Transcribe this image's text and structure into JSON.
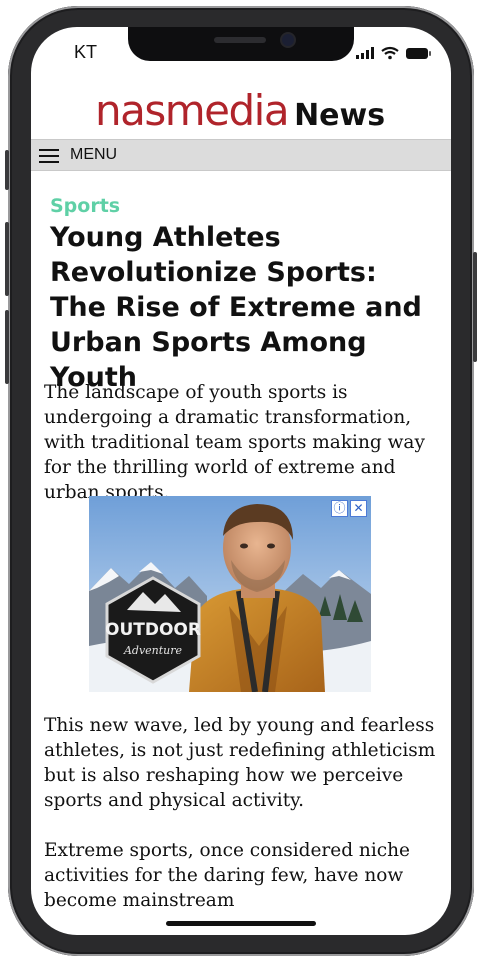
{
  "status_bar": {
    "carrier": "KT"
  },
  "header": {
    "brand": "nasmedia",
    "section": "News",
    "menu_label": "MENU"
  },
  "article": {
    "category": "Sports",
    "headline": "Young Athletes Revolutionize Sports: The Rise of Extreme and Urban Sports Among Youth",
    "paragraphs": [
      "The landscape of youth sports is undergoing a dramatic transformation, with traditional team sports making way for the thrilling world of extreme and urban sports.",
      "This new wave, led by young and fearless athletes, is not just redefining athleticism but is also reshaping how we perceive sports and physical activity.",
      "Extreme sports, once considered niche activities for the daring few, have now become mainstream"
    ]
  },
  "ad": {
    "logo_text": "OUTDOOR",
    "logo_subtext": "Adventure",
    "info_icon": "info-icon",
    "close_icon": "close-icon"
  },
  "colors": {
    "brand_red": "#b0242b",
    "category_green": "#5fd0a6",
    "menu_bar_bg": "#dcdcdc"
  }
}
